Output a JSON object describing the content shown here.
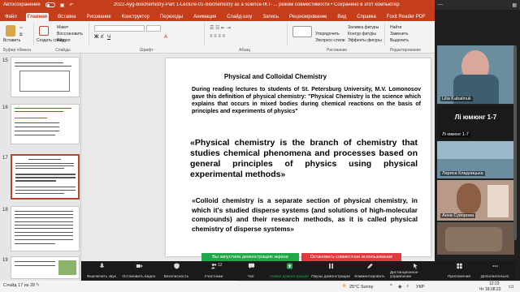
{
  "titlebar": {
    "autosave_label": "Автосохранение",
    "doc_title": "2022-Ayg-Biochemistry-Part 1-Lecture-01-Biochemistry as a science-IKT- ... режим совместимости • Сохранено в этот компьютер",
    "search_placeholder": "Поиск"
  },
  "tabs": [
    "Файл",
    "Главная",
    "Вставка",
    "Рисование",
    "Конструктор",
    "Переходы",
    "Анимация",
    "Слайд-шоу",
    "Запись",
    "Рецензирование",
    "Вид",
    "Справка",
    "Foxit Reader PDF"
  ],
  "ribbon": {
    "paste": "Вставить",
    "clipboard": "Буфер обмена",
    "create_slide": "Создать слайд",
    "layout": "Макет",
    "reset": "Восстановить",
    "section": "Раздел",
    "slides": "Слайды",
    "font": "Шрифт",
    "paragraph": "Абзац",
    "arrange": "Упорядочить",
    "express_styles": "Экспресс-стили",
    "shape_fill": "Заливка фигуры",
    "shape_outline": "Контур фигуры",
    "shape_effects": "Эффекты фигуры",
    "drawing": "Рисование",
    "find": "Найти",
    "replace": "Заменить",
    "select": "Выделить",
    "editing": "Редактирование"
  },
  "thumbnails": [
    {
      "num": "15",
      "selected": false
    },
    {
      "num": "16",
      "selected": false
    },
    {
      "num": "17",
      "selected": true
    },
    {
      "num": "18",
      "selected": false
    },
    {
      "num": "19",
      "selected": false
    }
  ],
  "slide": {
    "title": "Physical and Colloidal Chemistry",
    "p1": "During reading lectures to students of St. Petersburg University, M.V. Lomonosov gave this definition of physical chemistry: \"Physical Chemistry is the science which explains that occurs in mixed bodies during chemical reactions on the basis of principles and experiments of physics\"",
    "p2": "«Physical chemistry is the branch of chemistry that studies chemical phenomena and processes based on general principles of physics using physical experimental methods»",
    "p3": "«Colloid chemistry is a separate section of physical chemistry, in which it's studied disperse systems (and solutions of high-molecular compounds) and their research methods, as it is called physical chemistry of disperse systems»"
  },
  "zoom_panel": {
    "participants": [
      {
        "name": "Lilia Kabaitnuk",
        "caption": "",
        "type": "video"
      },
      {
        "name": "Лі юмюнг 1-7",
        "caption": "Лі юмюнг 1-7",
        "type": "name"
      },
      {
        "name": "Лариса Кладницька",
        "caption": "",
        "type": "video"
      },
      {
        "name": "Анна Суворова",
        "caption": "",
        "type": "video"
      }
    ]
  },
  "banner": {
    "sharing_msg": "Вы запустили демонстрацию экрана",
    "stop_msg": "Остановить совместное использование"
  },
  "zoombar": {
    "buttons": [
      {
        "label": "Выключить звук",
        "icon": "microphone-icon"
      },
      {
        "label": "Остановить видео",
        "icon": "video-camera-icon"
      },
      {
        "label": "Безопасность",
        "icon": "shield-icon"
      },
      {
        "label": "Участники",
        "icon": "participants-icon",
        "count": "12"
      },
      {
        "label": "Чат",
        "icon": "chat-icon"
      },
      {
        "label": "Новая демонстрация",
        "icon": "share-screen-icon"
      },
      {
        "label": "Паузы демонстрации",
        "icon": "pause-icon"
      },
      {
        "label": "Комментировать",
        "icon": "annotate-icon"
      },
      {
        "label": "Дистанционное управление",
        "icon": "remote-control-icon"
      },
      {
        "label": "Приложения",
        "icon": "apps-icon"
      },
      {
        "label": "Дополнительно",
        "icon": "more-icon"
      }
    ]
  },
  "statusbar": {
    "slide_info": "Слайд 17 из 28"
  },
  "taskbar": {
    "weather": "25°C  Sunny",
    "lang": "УКР",
    "time": "12:23",
    "date": "Чт 18.08.22"
  },
  "colors": {
    "ppt_brand": "#c43e1c",
    "zoom_green": "#22a64a",
    "zoom_red": "#e0393e"
  }
}
